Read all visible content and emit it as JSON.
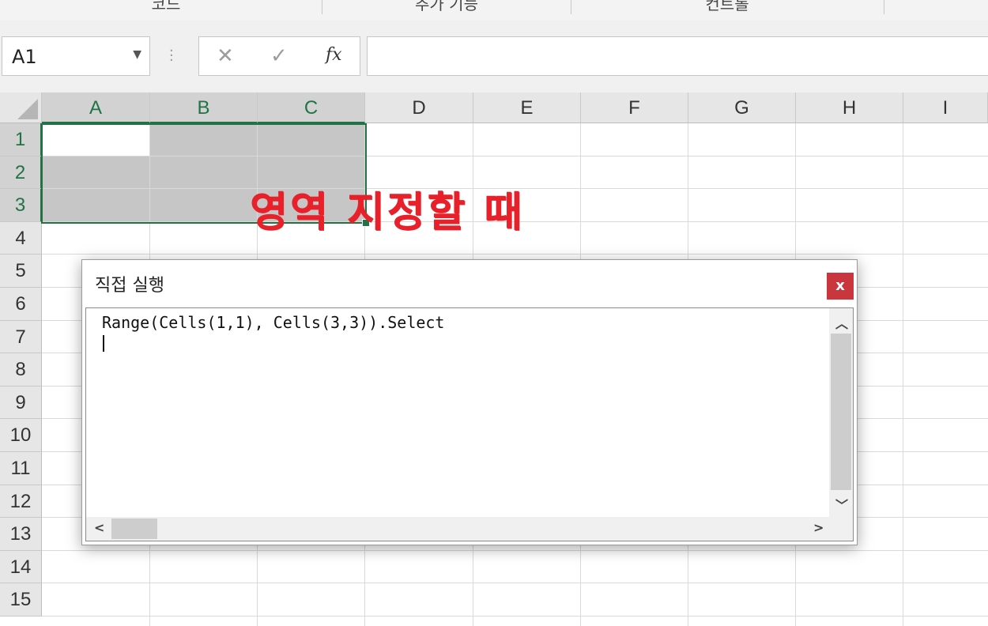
{
  "ribbon": {
    "groups": [
      "코드",
      "추가 기능",
      "컨트롤"
    ]
  },
  "formula_bar": {
    "name_box": "A1",
    "cancel_symbol": "✕",
    "enter_symbol": "✓",
    "fx_label": "fx",
    "formula": ""
  },
  "sheet": {
    "columns": [
      "A",
      "B",
      "C",
      "D",
      "E",
      "F",
      "G",
      "H",
      "I"
    ],
    "rows": [
      "1",
      "2",
      "3",
      "4",
      "5",
      "6",
      "7",
      "8",
      "9",
      "10",
      "11",
      "12",
      "13",
      "14",
      "15"
    ],
    "selection": "A1:C3",
    "active_cell": "A1"
  },
  "annotation": "영역 지정할 때",
  "immediate_window": {
    "title": "직접 실행",
    "close_label": "x",
    "code": "Range(Cells(1,1), Cells(3,3)).Select"
  },
  "colors": {
    "selection_border": "#217346",
    "annotation": "#e8202a",
    "close_button": "#c9363e"
  }
}
